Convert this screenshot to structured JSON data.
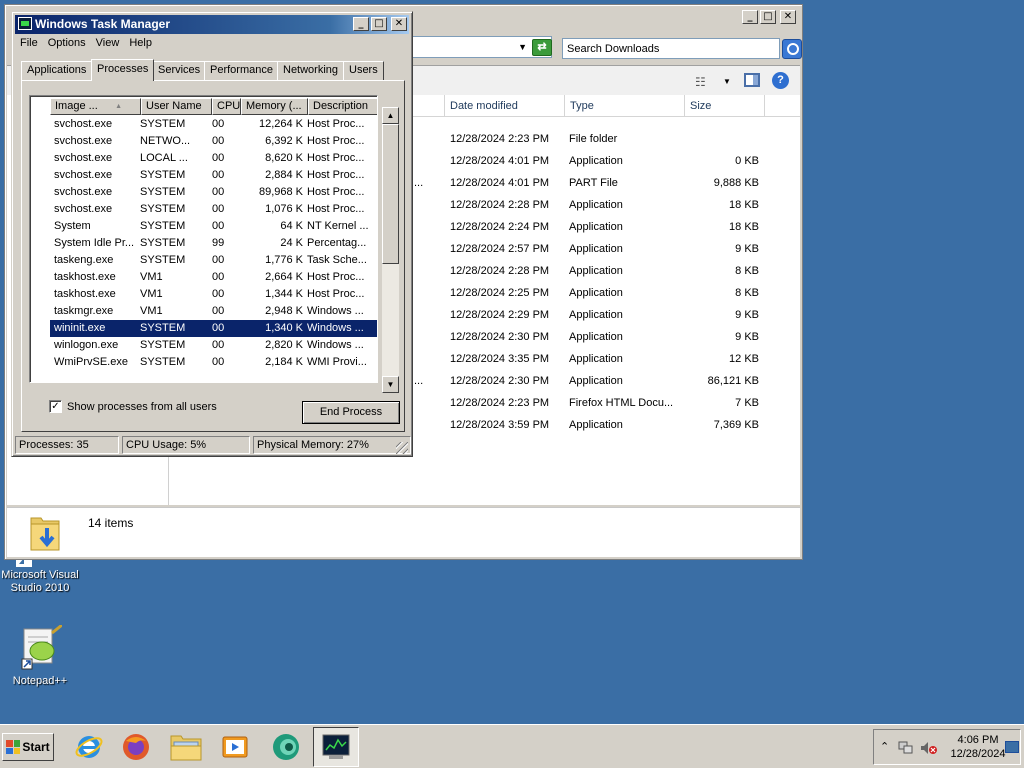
{
  "desktop": {
    "icons": [
      {
        "label_line1": "Microsoft Visual",
        "label_line2": "Studio 2010"
      },
      {
        "label_line1": "Notepad++",
        "label_line2": ""
      }
    ]
  },
  "explorer": {
    "search_placeholder": "Search Downloads",
    "columns": {
      "date": "Date modified",
      "type": "Type",
      "size": "Size"
    },
    "files": [
      {
        "date": "12/28/2024 2:23 PM",
        "type": "File folder",
        "size": "",
        "trunc": ""
      },
      {
        "date": "12/28/2024 4:01 PM",
        "type": "Application",
        "size": "0 KB",
        "trunc": ""
      },
      {
        "date": "12/28/2024 4:01 PM",
        "type": "PART File",
        "size": "9,888 KB",
        "trunc": "..."
      },
      {
        "date": "12/28/2024 2:28 PM",
        "type": "Application",
        "size": "18 KB",
        "trunc": ""
      },
      {
        "date": "12/28/2024 2:24 PM",
        "type": "Application",
        "size": "18 KB",
        "trunc": ""
      },
      {
        "date": "12/28/2024 2:57 PM",
        "type": "Application",
        "size": "9 KB",
        "trunc": ""
      },
      {
        "date": "12/28/2024 2:28 PM",
        "type": "Application",
        "size": "8 KB",
        "trunc": ""
      },
      {
        "date": "12/28/2024 2:25 PM",
        "type": "Application",
        "size": "8 KB",
        "trunc": ""
      },
      {
        "date": "12/28/2024 2:29 PM",
        "type": "Application",
        "size": "9 KB",
        "trunc": ""
      },
      {
        "date": "12/28/2024 2:30 PM",
        "type": "Application",
        "size": "9 KB",
        "trunc": ""
      },
      {
        "date": "12/28/2024 3:35 PM",
        "type": "Application",
        "size": "12 KB",
        "trunc": ""
      },
      {
        "date": "12/28/2024 2:30 PM",
        "type": "Application",
        "size": "86,121 KB",
        "trunc": "..."
      },
      {
        "date": "12/28/2024 2:23 PM",
        "type": "Firefox HTML Docu...",
        "size": "7 KB",
        "trunc": ""
      },
      {
        "date": "12/28/2024 3:59 PM",
        "type": "Application",
        "size": "7,369 KB",
        "trunc": ""
      }
    ],
    "status_items": "14 items"
  },
  "taskmgr": {
    "title": "Windows Task Manager",
    "menu": [
      "File",
      "Options",
      "View",
      "Help"
    ],
    "tabs": [
      "Applications",
      "Processes",
      "Services",
      "Performance",
      "Networking",
      "Users"
    ],
    "active_tab": "Processes",
    "columns": {
      "image": "Image ...",
      "user": "User Name",
      "cpu": "CPU",
      "mem": "Memory (...",
      "desc": "Description"
    },
    "processes": [
      {
        "name": "svchost.exe",
        "user": "SYSTEM",
        "cpu": "00",
        "mem": "12,264 K",
        "desc": "Host Proc..."
      },
      {
        "name": "svchost.exe",
        "user": "NETWO...",
        "cpu": "00",
        "mem": "6,392 K",
        "desc": "Host Proc..."
      },
      {
        "name": "svchost.exe",
        "user": "LOCAL ...",
        "cpu": "00",
        "mem": "8,620 K",
        "desc": "Host Proc..."
      },
      {
        "name": "svchost.exe",
        "user": "SYSTEM",
        "cpu": "00",
        "mem": "2,884 K",
        "desc": "Host Proc..."
      },
      {
        "name": "svchost.exe",
        "user": "SYSTEM",
        "cpu": "00",
        "mem": "89,968 K",
        "desc": "Host Proc..."
      },
      {
        "name": "svchost.exe",
        "user": "SYSTEM",
        "cpu": "00",
        "mem": "1,076 K",
        "desc": "Host Proc..."
      },
      {
        "name": "System",
        "user": "SYSTEM",
        "cpu": "00",
        "mem": "64 K",
        "desc": "NT Kernel ..."
      },
      {
        "name": "System Idle Pr...",
        "user": "SYSTEM",
        "cpu": "99",
        "mem": "24 K",
        "desc": "Percentag..."
      },
      {
        "name": "taskeng.exe",
        "user": "SYSTEM",
        "cpu": "00",
        "mem": "1,776 K",
        "desc": "Task Sche..."
      },
      {
        "name": "taskhost.exe",
        "user": "VM1",
        "cpu": "00",
        "mem": "2,664 K",
        "desc": "Host Proc..."
      },
      {
        "name": "taskhost.exe",
        "user": "VM1",
        "cpu": "00",
        "mem": "1,344 K",
        "desc": "Host Proc..."
      },
      {
        "name": "taskmgr.exe",
        "user": "VM1",
        "cpu": "00",
        "mem": "2,948 K",
        "desc": "Windows ..."
      },
      {
        "name": "wininit.exe",
        "user": "SYSTEM",
        "cpu": "00",
        "mem": "1,340 K",
        "desc": "Windows ..."
      },
      {
        "name": "winlogon.exe",
        "user": "SYSTEM",
        "cpu": "00",
        "mem": "2,820 K",
        "desc": "Windows ..."
      },
      {
        "name": "WmiPrvSE.exe",
        "user": "SYSTEM",
        "cpu": "00",
        "mem": "2,184 K",
        "desc": "WMI Provi..."
      }
    ],
    "selected_process": "wininit.exe",
    "show_all_label": "Show processes from all users",
    "show_all_checked": true,
    "end_process_label": "End Process",
    "status": {
      "processes": "Processes: 35",
      "cpu": "CPU Usage: 5%",
      "memory": "Physical Memory: 27%"
    }
  },
  "taskbar": {
    "start_label": "Start",
    "apps": [
      "internet-explorer-icon",
      "firefox-icon",
      "explorer-folder-icon",
      "media-player-icon",
      "web-browser-icon",
      "task-manager-icon"
    ],
    "clock_time": "4:06 PM",
    "clock_date": "12/28/2024"
  }
}
